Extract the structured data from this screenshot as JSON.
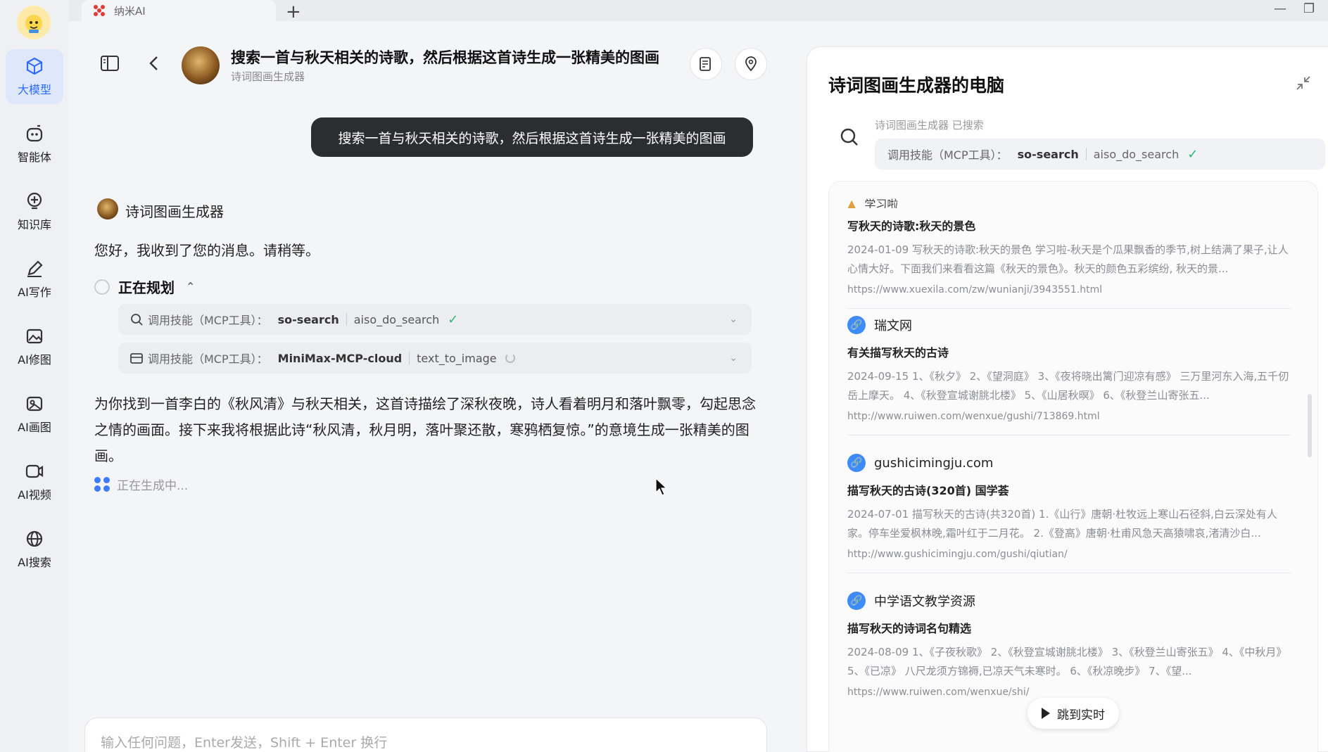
{
  "window": {
    "tab_title": "纳米AI",
    "new_tab": "+",
    "minimize": "—",
    "restore": "❐"
  },
  "sidebar": {
    "items": [
      {
        "label": "大模型",
        "icon": "cube-icon",
        "active": true
      },
      {
        "label": "智能体",
        "icon": "agent-icon",
        "active": false
      },
      {
        "label": "知识库",
        "icon": "knowledge-icon",
        "active": false
      },
      {
        "label": "AI写作",
        "icon": "pen-icon",
        "active": false
      },
      {
        "label": "AI修图",
        "icon": "image-edit-icon",
        "active": false
      },
      {
        "label": "AI画图",
        "icon": "paint-icon",
        "active": false
      },
      {
        "label": "AI视频",
        "icon": "video-icon",
        "active": false
      },
      {
        "label": "AI搜索",
        "icon": "globe-icon",
        "active": false
      }
    ]
  },
  "header": {
    "title": "搜索一首与秋天相关的诗歌，然后根据这首诗生成一张精美的图画",
    "subtitle": "诗词图画生成器"
  },
  "chat": {
    "user_message": "搜索一首与秋天相关的诗歌，然后根据这首诗生成一张精美的图画",
    "bot_name": "诗词图画生成器",
    "greeting": "您好，我收到了您的消息。请稍等。",
    "planning_label": "正在规划",
    "tools": [
      {
        "prefix": "调用技能（MCP工具）：",
        "name": "so-search",
        "fn": "aiso_do_search",
        "status": "done"
      },
      {
        "prefix": "调用技能（MCP工具）：",
        "name": "MiniMax-MCP-cloud",
        "fn": "text_to_image",
        "status": "loading"
      }
    ],
    "answer": "为你找到一首李白的《秋风清》与秋天相关，这首诗描绘了深秋夜晚，诗人看着明月和落叶飘零，勾起思念之情的画面。接下来我将根据此诗“秋风清，秋月明，落叶聚还散，寒鸦栖复惊。”的意境生成一张精美的图画。",
    "generating": "正在生成中...",
    "input_placeholder": "输入任何问题，Enter发送，Shift + Enter 换行"
  },
  "panel": {
    "title": "诗词图画生成器的电脑",
    "search_meta": "诗词图画生成器 已搜索",
    "tool": {
      "prefix": "调用技能（MCP工具）：",
      "name": "so-search",
      "fn": "aiso_do_search"
    },
    "partial_source": "学习啦",
    "results": [
      {
        "source": "",
        "title": "写秋天的诗歌:秋天的景色",
        "snippet": "2024-01-09 写秋天的诗歌:秋天的景色 学习啦-秋天是个瓜果飘香的季节,树上结满了果子,让人心情大好。下面我们来看看这篇《秋天的景色》。秋天的颜色五彩缤纷, 秋天的景...",
        "url": "https://www.xuexila.com/zw/wunianji/3943551.html"
      },
      {
        "source": "瑞文网",
        "title": "有关描写秋天的古诗",
        "snippet": "2024-09-15 1、《秋夕》 2、《望洞庭》 3、《夜将晓出篱门迎凉有感》 三万里河东入海,五千仞岳上摩天。 4、《秋登宣城谢朓北楼》 5、《山居秋暝》 6、《秋登兰山寄张五...",
        "url": "http://www.ruiwen.com/wenxue/gushi/713869.html"
      },
      {
        "source": "gushicimingju.com",
        "title": "描写秋天的古诗(320首) 国学荟",
        "snippet": "2024-07-01 描写秋天的古诗(共320首) 1.《山行》唐朝·杜牧远上寒山石径斜,白云深处有人家。停车坐爱枫林晚,霜叶红于二月花。 2.《登高》唐朝·杜甫风急天高猿啸哀,渚清沙白...",
        "url": "http://www.gushicimingju.com/gushi/qiutian/"
      },
      {
        "source": "中学语文教学资源",
        "title": "描写秋天的诗词名句精选",
        "snippet": "2024-08-09 1、《子夜秋歌》 2、《秋登宣城谢朓北楼》 3、《秋登兰山寄张五》 4、《中秋月》 5、《已凉》 八尺龙须方锦褥,已凉天气未寒时。 6、《秋凉晚步》 7、《望...",
        "url": "https://www.ruiwen.com/wenxue/shi/"
      }
    ],
    "jump_button": "跳到实时"
  },
  "colors": {
    "accent": "#2f6bff",
    "success": "#2bb673",
    "bubble": "#2b2d31"
  }
}
